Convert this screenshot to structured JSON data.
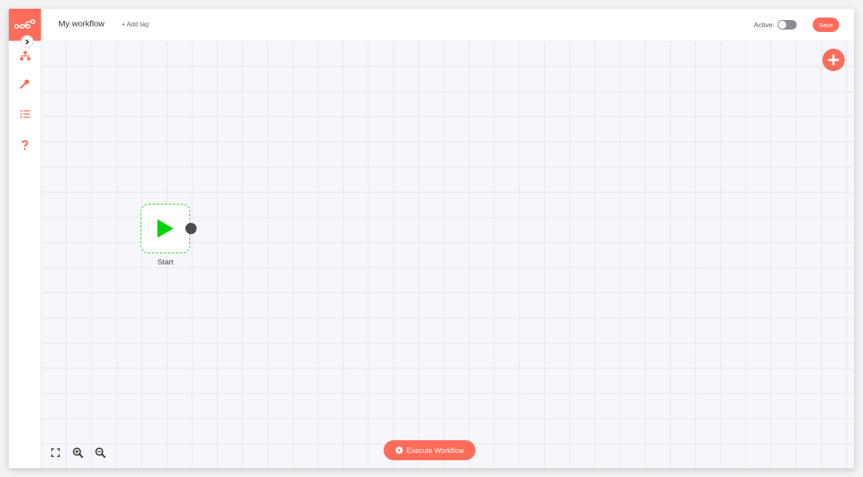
{
  "app": {
    "logo_icon": "n8n-logo-icon",
    "accent_color": "#ff6d5a"
  },
  "sidebar": {
    "collapse_icon": "chevron-right-icon",
    "items": [
      {
        "name": "workflows",
        "icon": "network-icon"
      },
      {
        "name": "credentials",
        "icon": "key-icon"
      },
      {
        "name": "executions",
        "icon": "tasks-list-icon"
      },
      {
        "name": "help",
        "icon": "question-icon"
      }
    ]
  },
  "header": {
    "workflow_name": "My workflow",
    "add_tag_label": "+ Add tag",
    "active_label": "Active:",
    "active_state": false,
    "save_label": "Save"
  },
  "canvas": {
    "add_node_icon": "plus-icon",
    "nodes": [
      {
        "label": "Start",
        "icon": "play-icon",
        "icon_color": "#00d400"
      }
    ],
    "zoom_tools": [
      "fullscreen-icon",
      "zoom-in-icon",
      "zoom-out-icon"
    ],
    "execute_label": "Execute Workflow",
    "execute_icon": "play-circle-icon"
  }
}
